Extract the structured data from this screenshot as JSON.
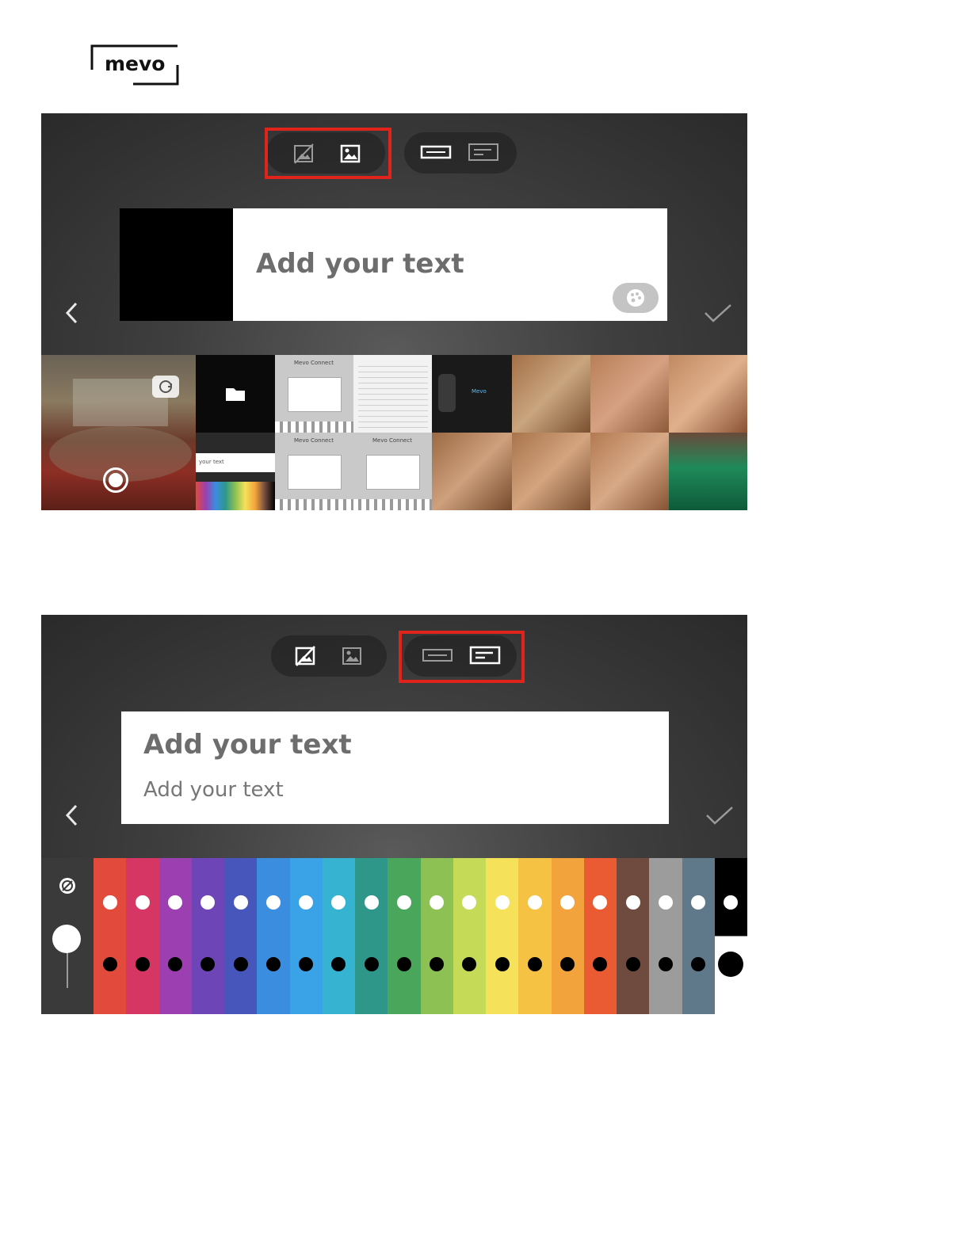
{
  "logo": {
    "text": "mevo"
  },
  "panel1": {
    "card": {
      "main_text": "Add your text"
    },
    "toolbar": {
      "group1_highlighted": true,
      "icons": [
        "no-image-icon",
        "image-icon",
        "lower-third-single-icon",
        "lower-third-double-icon"
      ]
    },
    "thumbnails": [
      {
        "kind": "camera-live",
        "label": ""
      },
      {
        "kind": "folder"
      },
      {
        "kind": "dialog",
        "title": "Mevo Connect"
      },
      {
        "kind": "list"
      },
      {
        "kind": "speaker",
        "label": "Mevo"
      },
      {
        "kind": "photo"
      },
      {
        "kind": "photo"
      },
      {
        "kind": "photo"
      },
      {
        "kind": "text-ui",
        "label": "your text"
      },
      {
        "kind": "dialog",
        "title": "Mevo Connect"
      },
      {
        "kind": "dialog",
        "title": "Mevo Connect"
      },
      {
        "kind": "photo"
      },
      {
        "kind": "photo"
      },
      {
        "kind": "photo"
      },
      {
        "kind": "bottle"
      }
    ]
  },
  "panel2": {
    "card": {
      "main_text": "Add your text",
      "sub_text": "Add your text"
    },
    "toolbar": {
      "group2_highlighted": true,
      "icons": [
        "no-image-icon",
        "image-icon",
        "lower-third-single-icon",
        "lower-third-double-icon"
      ]
    },
    "palette": {
      "colors": [
        "#e24a3b",
        "#d53663",
        "#9b3fb1",
        "#6e45b6",
        "#4756ba",
        "#3a8ddf",
        "#3aa2e6",
        "#35b3d0",
        "#2e978a",
        "#4aa65a",
        "#8dc154",
        "#c5da57",
        "#f6e15a",
        "#f5c244",
        "#f3a33b",
        "#ea5a33",
        "#6f4a3e",
        "#9c9c9c",
        "#60798a",
        "#000000"
      ],
      "last_bottom": "#ffffff",
      "opacity_slider": 0.85
    }
  },
  "colors": {
    "highlight": "#e0241b"
  }
}
